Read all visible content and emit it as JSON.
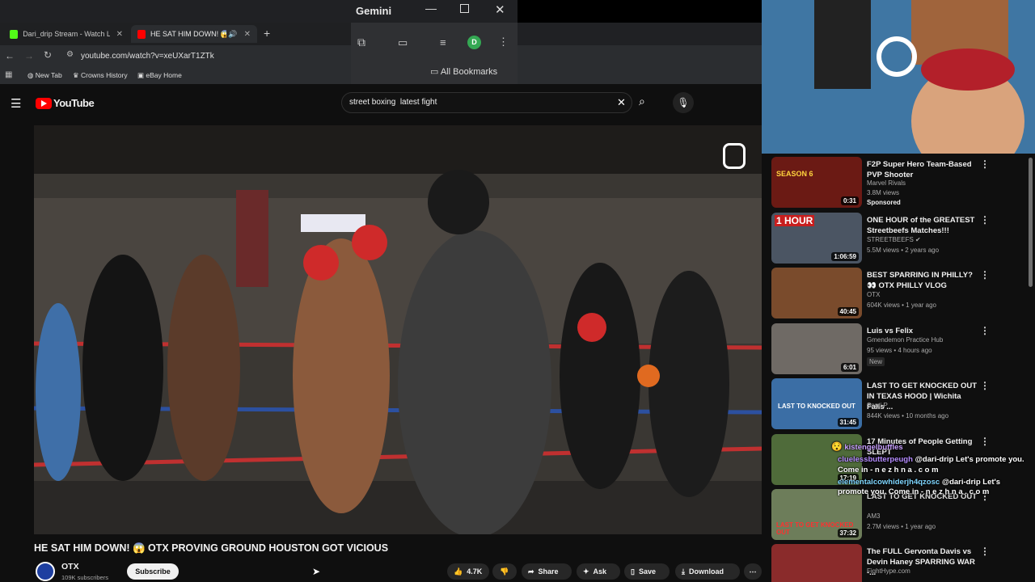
{
  "browser": {
    "tabs": [
      {
        "title": "Dari_drip Stream - Watch Live o",
        "active": false,
        "favicon_color": "#53fc18"
      },
      {
        "title": "HE SAT HIM DOWN! 😱 OT",
        "active": true,
        "favicon_color": "#ff0000"
      }
    ],
    "new_tab_symbol": "+",
    "address": "youtube.com/watch?v=xeUXarT1ZTk",
    "bookmarks": [
      "New Tab",
      "Crowns History",
      "eBay Home"
    ],
    "all_bookmarks": "All Bookmarks",
    "gemini_label": "Gemini",
    "profile_initial": "D"
  },
  "youtube": {
    "logo_text": "YouTube",
    "search_value": "street boxing  latest fight",
    "video_title": "HE SAT HIM DOWN! 😱 OTX PROVING GROUND HOUSTON GOT VICIOUS",
    "channel_name": "OTX",
    "subscribers": "109K subscribers",
    "subscribe_label": "Subscribe",
    "actions": {
      "likes": "4.7K",
      "share": "Share",
      "ask": "Ask",
      "save": "Save",
      "download": "Download"
    }
  },
  "recommendations": [
    {
      "title": "F2P Super Hero Team-Based PVP Shooter",
      "channel": "Marvel Rivals",
      "meta": "3.8M views",
      "extra": "Sponsored",
      "duration": "0:31",
      "thumb_color": "#6b1a14",
      "thumb_text": "SEASON 6"
    },
    {
      "title": "ONE HOUR of the GREATEST Streetbeefs Matches!!!",
      "channel": "STREETBEEFS",
      "meta": "5.5M views • 2 years ago",
      "extra": "",
      "duration": "1:06:59",
      "thumb_color": "#4b5563",
      "thumb_text": "1 HOUR"
    },
    {
      "title": "BEST SPARRING IN PHILLY? 👀 OTX PHILLY VLOG",
      "channel": "OTX",
      "meta": "604K views • 1 year ago",
      "extra": "",
      "duration": "40:45",
      "thumb_color": "#7a4b2c",
      "thumb_text": ""
    },
    {
      "title": "Luis vs Felix",
      "channel": "Gmendemon Practice Hub",
      "meta": "95 views • 4 hours ago",
      "extra": "New",
      "duration": "6:01",
      "thumb_color": "#6f6a65",
      "thumb_text": ""
    },
    {
      "title": "LAST TO GET KNOCKED OUT IN TEXAS HOOD | Wichita Falls ...",
      "channel": "Santi P",
      "meta": "844K views • 10 months ago",
      "extra": "",
      "duration": "31:45",
      "thumb_color": "#3b6ea5",
      "thumb_text": "LAST TO KNOCKED OUT"
    },
    {
      "title": "17 Minutes of People Getting SLEPT",
      "channel": "",
      "meta": "",
      "extra": "",
      "duration": "17:19",
      "thumb_color": "#4f6b3a",
      "thumb_text": ""
    },
    {
      "title": "LAST TO GET KNOCKED OUT",
      "channel": "AM3",
      "meta": "2.7M views • 1 year ago",
      "extra": "",
      "duration": "37:32",
      "thumb_color": "#6d7d5a",
      "thumb_text": "LAST TO GET KNOCKED OUT"
    },
    {
      "title": "The FULL Gervonta Davis vs Devin Haney SPARRING WAR -...",
      "channel": "FightHype.com",
      "meta": "",
      "extra": "",
      "duration": "",
      "thumb_color": "#8a2b2b",
      "thumb_text": ""
    }
  ],
  "chat": [
    {
      "user": "kistengelbuffles",
      "msg": "",
      "user_color": "#c9a0ff"
    },
    {
      "user": "cluelessbutterpeugh",
      "msg": "@dari-drip Let's promote you.",
      "user_color": "#b58cff"
    },
    {
      "user": "",
      "msg": "Come in - n e z h n a . c o m",
      "user_color": "#ffffff"
    },
    {
      "user": "elementalcowhiderjh4qzosc",
      "msg": "@dari-drip Let's",
      "user_color": "#7fd6ff"
    },
    {
      "user": "",
      "msg": "promote you. Come in - n e z h n a . c o m",
      "user_color": "#ffffff"
    }
  ],
  "colors": {
    "yt_red": "#ff0000",
    "bg": "#0f0f0f",
    "chrome": "#202124"
  }
}
